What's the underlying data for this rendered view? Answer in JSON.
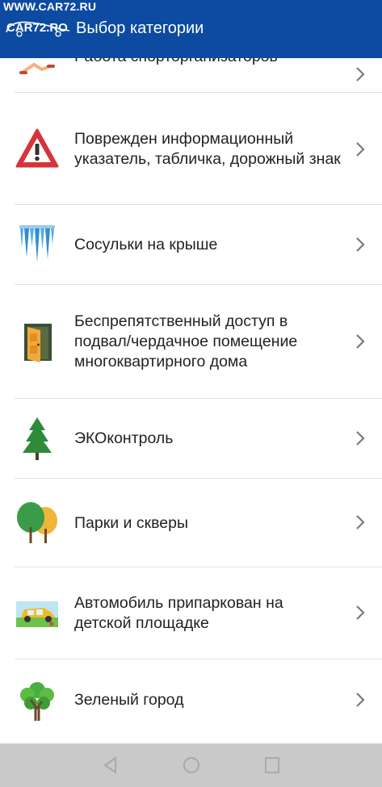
{
  "watermark": {
    "top": "WWW.CAR72.RU",
    "logo": "CAR72.RO"
  },
  "header": {
    "title": "Выбор категории"
  },
  "list": {
    "items": [
      {
        "label": "Работа спорторганизаторов",
        "icon": "runner-icon"
      },
      {
        "label": "Поврежден информационный указатель, табличка, дорожный знак",
        "icon": "warning-sign-icon"
      },
      {
        "label": "Сосульки на крыше",
        "icon": "icicles-icon"
      },
      {
        "label": "Беспрепятственный доступ в подвал/чердачное помещение многоквартирного дома",
        "icon": "open-door-icon"
      },
      {
        "label": "ЭКОконтроль",
        "icon": "fir-tree-icon"
      },
      {
        "label": "Парки и скверы",
        "icon": "park-trees-icon"
      },
      {
        "label": "Автомобиль припаркован на детской площадке",
        "icon": "parked-car-icon"
      },
      {
        "label": "Зеленый город",
        "icon": "green-tree-icon"
      }
    ]
  },
  "navbar": {
    "buttons": [
      "back-icon",
      "home-icon",
      "recents-icon"
    ]
  }
}
